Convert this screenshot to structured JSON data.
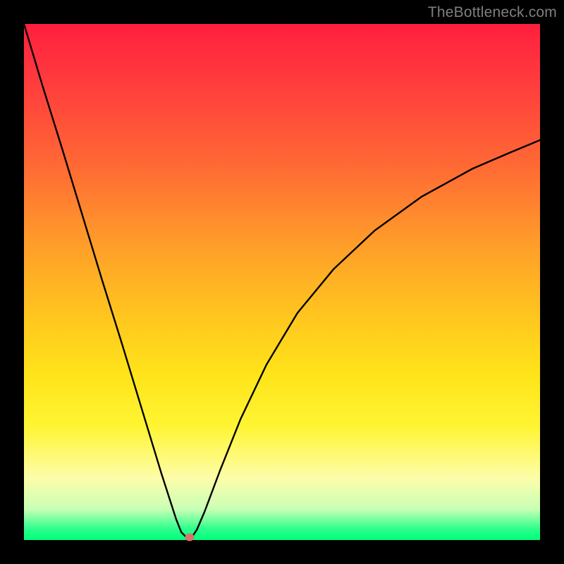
{
  "watermark": "TheBottleneck.com",
  "marker": {
    "x_frac": 0.321,
    "y_frac": 0.995,
    "color": "#d8746b"
  },
  "chart_data": {
    "type": "line",
    "title": "",
    "xlabel": "",
    "ylabel": "",
    "xlim": [
      0,
      1
    ],
    "ylim": [
      0,
      1
    ],
    "note": "Axes are unlabeled; x and y are normalized to the plot box (0–1). y=1 is the top edge (red), y=0 is the bottom edge (green). The curve drops nearly linearly from top-left to a minimum near x≈0.31 (y≈0), then rises with decreasing slope toward the right edge reaching y≈0.77 at x=1.",
    "series": [
      {
        "name": "bottleneck-curve",
        "x": [
          0.0,
          0.036,
          0.075,
          0.113,
          0.151,
          0.19,
          0.228,
          0.266,
          0.295,
          0.305,
          0.315,
          0.325,
          0.335,
          0.35,
          0.38,
          0.42,
          0.47,
          0.53,
          0.6,
          0.68,
          0.77,
          0.87,
          0.94,
          1.0
        ],
        "y": [
          1.0,
          0.88,
          0.755,
          0.63,
          0.505,
          0.38,
          0.255,
          0.13,
          0.04,
          0.015,
          0.005,
          0.005,
          0.02,
          0.055,
          0.135,
          0.235,
          0.34,
          0.44,
          0.525,
          0.6,
          0.665,
          0.72,
          0.75,
          0.775
        ]
      }
    ],
    "annotations": [
      {
        "name": "min-marker",
        "x": 0.321,
        "y": 0.005,
        "color": "#d8746b"
      }
    ],
    "background_gradient": {
      "direction": "top-to-bottom",
      "stops": [
        {
          "pos": 0.0,
          "color": "#ff1f3e"
        },
        {
          "pos": 0.28,
          "color": "#ff6b34"
        },
        {
          "pos": 0.56,
          "color": "#ffc41f"
        },
        {
          "pos": 0.78,
          "color": "#fff533"
        },
        {
          "pos": 0.94,
          "color": "#c9ffb5"
        },
        {
          "pos": 1.0,
          "color": "#00ff7b"
        }
      ]
    }
  }
}
